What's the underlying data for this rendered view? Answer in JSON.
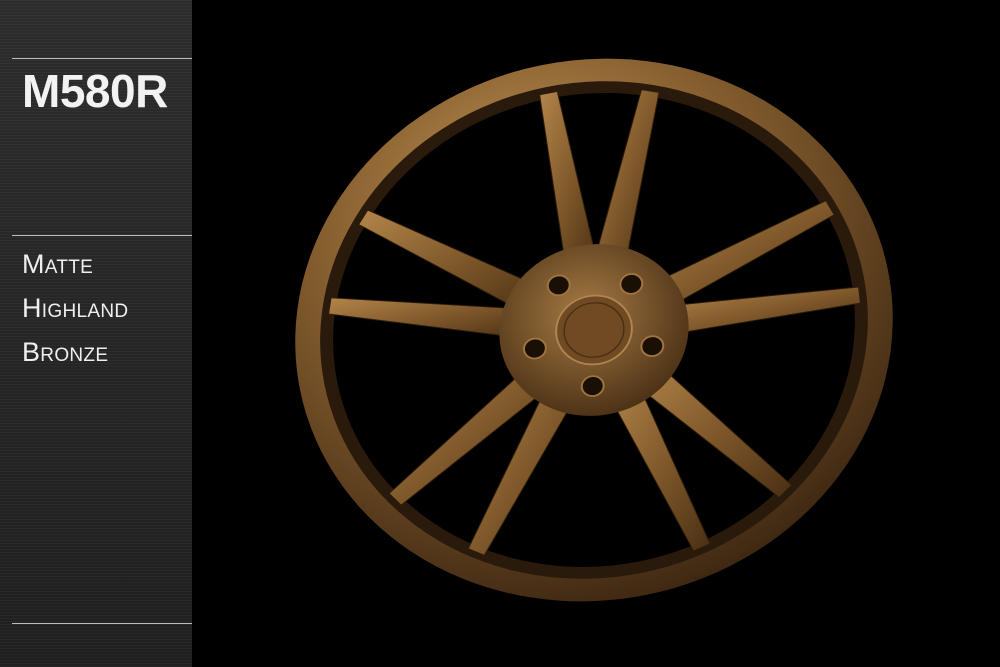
{
  "sidebar": {
    "model": "M580R",
    "finish_words": [
      "Matte",
      "Highland",
      "Bronze"
    ]
  },
  "photo": {
    "subject": "wheel-image",
    "rim_color": "#8a6231",
    "highlight_color": "#c89a5c",
    "shadow_color": "#3a2410",
    "background_color": "#000000",
    "spoke_pairs": 5
  }
}
